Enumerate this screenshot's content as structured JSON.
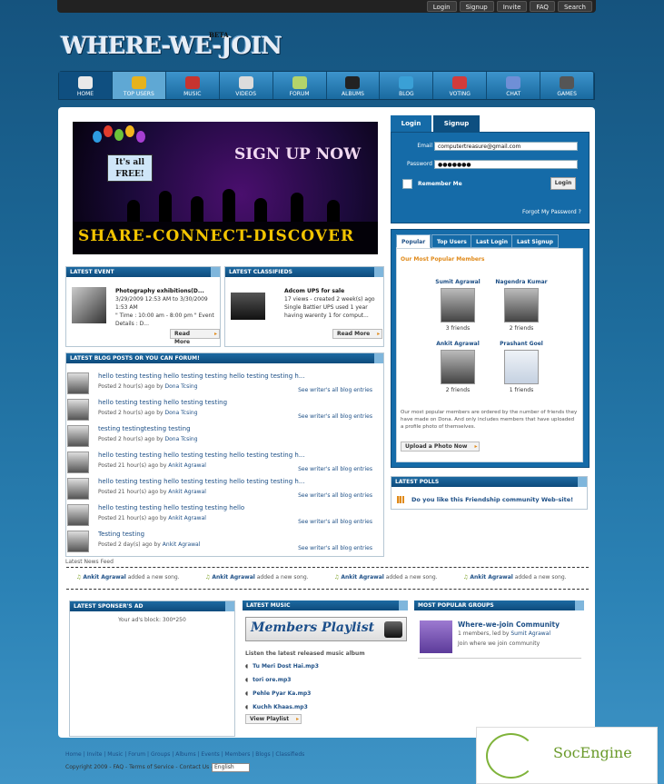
{
  "topbar": {
    "links": [
      "Login",
      "Signup",
      "Invite",
      "FAQ",
      "Search"
    ]
  },
  "logo": {
    "text": "WHERE-WE-JOIN",
    "badge": "BETA"
  },
  "nav": [
    "HOME",
    "TOP USERS",
    "MUSIC",
    "VIDEOS",
    "FORUM",
    "ALBUMS",
    "BLOG",
    "VOTING",
    "CHAT",
    "GAMES"
  ],
  "banner": {
    "free": "It's all FREE!",
    "signup": "SIGN UP NOW",
    "tagline": "SHARE-CONNECT-DISCOVER"
  },
  "event": {
    "header": "LATEST EVENT",
    "title": "Photography exhibitions(D...",
    "date": "3/29/2009 12:53 AM to 3/30/2009 1:53 AM",
    "desc": "\" Time : 10:00 am - 8:00 pm \" Event Details : D...",
    "readmore": "Read More"
  },
  "classified": {
    "header": "LATEST CLASSIFIEDS",
    "title": "Adcom UPS for sale",
    "meta": "17 views - created 2 week(s) ago",
    "desc": "Single Battier UPS used 1 year having warenty 1 for comput...",
    "readmore": "Read More"
  },
  "blog": {
    "header": "LATEST BLOG POSTS OR YOU CAN FORUM!",
    "rows": [
      {
        "title": "hello testing testing hello testing testing hello testing testing h...",
        "posted": "Posted 2 hour(s) ago by ",
        "author": "Dona Tcsing",
        "right": "See writer's all blog entries"
      },
      {
        "title": "hello testing testing hello testing testing",
        "posted": "Posted 2 hour(s) ago by ",
        "author": "Dona Tcsing",
        "right": "See writer's all blog entries"
      },
      {
        "title": "testing testingtesting testing",
        "posted": "Posted 2 hour(s) ago by ",
        "author": "Dona Tcsing",
        "right": ""
      },
      {
        "title": "hello testing testing hello testing testing hello testing testing h...",
        "posted": "Posted 21 hour(s) ago by ",
        "author": "Ankit Agrawal",
        "right": "See writer's all blog entries"
      },
      {
        "title": "hello testing testing hello testing testing hello testing testing h...",
        "posted": "Posted 21 hour(s) ago by ",
        "author": "Ankit Agrawal",
        "right": "See writer's all blog entries"
      },
      {
        "title": "hello testing testing hello testing testing hello",
        "posted": "Posted 21 hour(s) ago by ",
        "author": "Ankit Agrawal",
        "right": "See writer's all blog entries"
      },
      {
        "title": "Testing testing",
        "posted": "Posted 2 day(s) ago by ",
        "author": "Ankit Agrawal",
        "right": "See writer's all blog entries"
      }
    ]
  },
  "login": {
    "tab_login": "Login",
    "tab_signup": "Signup",
    "email_label": "Email",
    "email_value": "computertreasure@gmail.com",
    "password_label": "Password",
    "password_value": "●●●●●●●",
    "remember": "Remember Me",
    "button": "Login",
    "forgot": "Forgot My Password ?"
  },
  "popular": {
    "tabs": [
      "Popular",
      "Top Users",
      "Last Login",
      "Last Signup"
    ],
    "heading": "Our Most Popular Members",
    "members": [
      {
        "name": "Sumit Agrawal",
        "friends": "3 friends"
      },
      {
        "name": "Nagendra Kumar",
        "friends": "2 friends"
      },
      {
        "name": "Ankit Agrawal",
        "friends": "2 friends"
      },
      {
        "name": "Prashant Goel",
        "friends": "1 friends"
      }
    ],
    "desc": "Our most popular members are ordered by the number of friends they have made on Dona. And only includes members that have uploaded a profile photo of themselves.",
    "upload": "Upload a Photo Now"
  },
  "polls": {
    "header": "LATEST POLLS",
    "question": "Do you like this Friendship community Web-site!"
  },
  "news": {
    "label": "Latest News Feed",
    "items": [
      {
        "user": "Ankit Agrawal",
        "action": " added a new song."
      },
      {
        "user": "Ankit Agrawal",
        "action": " added a new song."
      },
      {
        "user": "Ankit Agrawal",
        "action": " added a new song."
      },
      {
        "user": "Ankit Agrawal",
        "action": " added a new song."
      }
    ]
  },
  "sponsor": {
    "header": "LATEST SPONSER'S AD",
    "text": "Your ad's block: 300*250"
  },
  "music": {
    "header": "LATEST MUSIC",
    "playlist": "Members Playlist",
    "listen": "Listen the latest released music album",
    "songs": [
      "Tu Meri Dost Hai.mp3",
      "tori ore.mp3",
      "Pehle Pyar Ka.mp3",
      "Kuchh Khaas.mp3"
    ],
    "button": "View Playlist"
  },
  "groups": {
    "header": "MOST POPULAR GROUPS",
    "name": "Where-we-join Community",
    "meta": "1 members, led by ",
    "leader": "Sumit Agrawal",
    "desc": "Join where we join community"
  },
  "footer": {
    "links": "Home | Invite | Music | Forum | Groups | Albums | Events | Members | Blogs | Classifieds",
    "copy": "Copyright 2009 - FAQ - Terms of Service - Contact Us -",
    "language": "English",
    "brand": "SocEngine"
  }
}
